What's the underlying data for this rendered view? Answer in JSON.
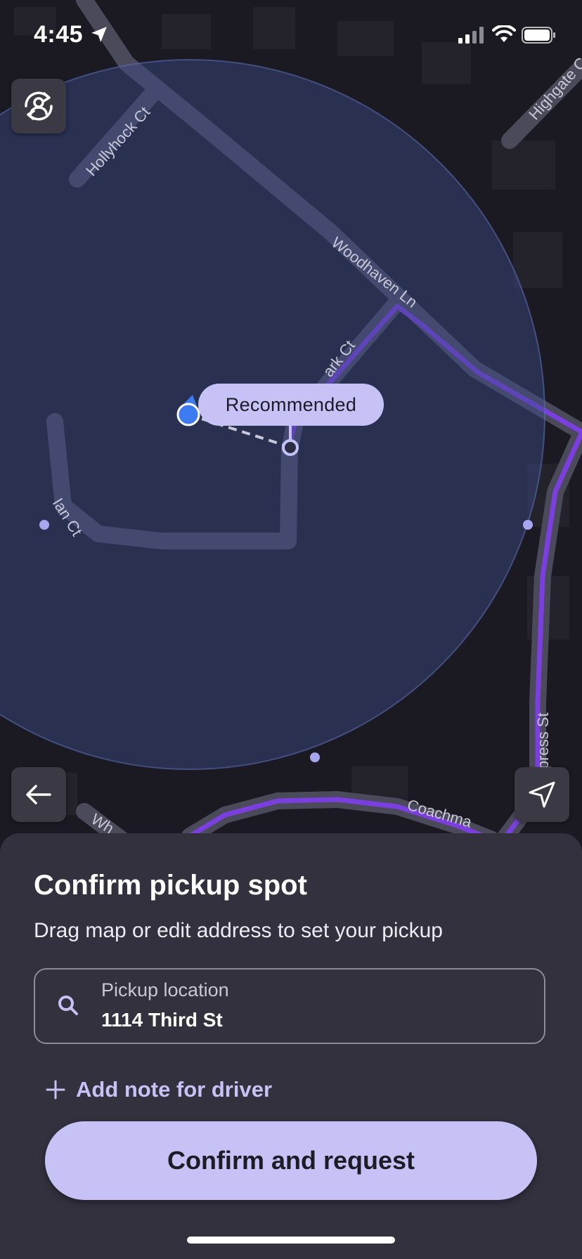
{
  "status_bar": {
    "time": "4:45"
  },
  "map": {
    "streets": [
      "Hollyhock Ct",
      "Highgate C",
      "Woodhaven Ln",
      "ark Ct",
      "Ian Ct",
      "press St",
      "Coachma",
      "Wh"
    ],
    "recommended_label": "Recommended"
  },
  "sheet": {
    "title": "Confirm pickup spot",
    "subtitle": "Drag map or edit address to set your pickup",
    "pickup": {
      "label": "Pickup location",
      "value": "1114 Third St"
    },
    "add_note_label": "Add note for driver",
    "confirm_button_label": "Confirm and request"
  },
  "colors": {
    "accent": "#c6c2f6",
    "route": "#7b3fe0",
    "sheet_bg": "#32313d",
    "map_bg": "#1b1a22",
    "user_dot": "#3d7bf0"
  },
  "icons": {
    "top_left_button": "switch-rider-icon",
    "back_button": "arrow-left-icon",
    "locate_button": "navigation-arrow-icon",
    "field_icon": "search-icon",
    "add_note_icon": "plus-icon"
  }
}
